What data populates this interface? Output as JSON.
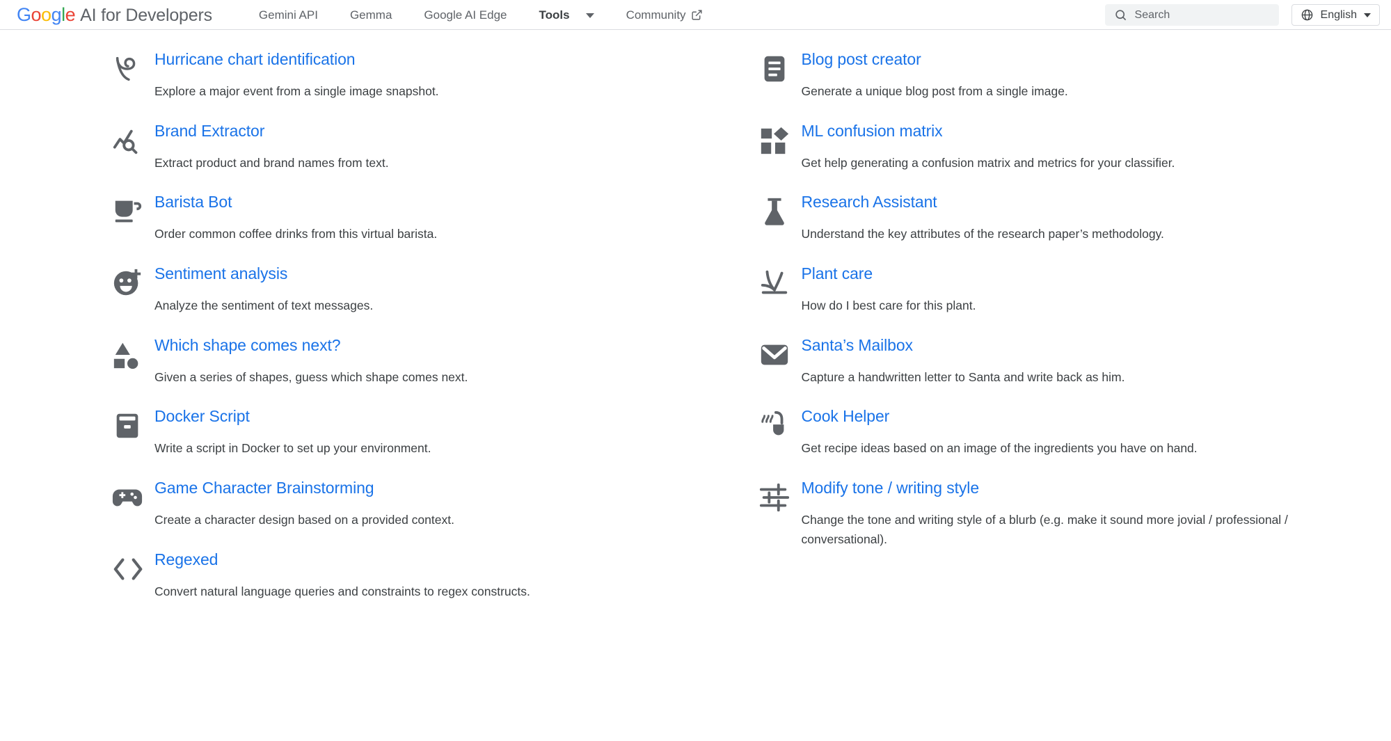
{
  "header": {
    "brand": {
      "google": "Google",
      "suffix": "AI for Developers"
    },
    "nav": [
      {
        "label": "Gemini API",
        "icon": "",
        "active": false
      },
      {
        "label": "Gemma",
        "icon": "",
        "active": false
      },
      {
        "label": "Google AI Edge",
        "icon": "",
        "active": false
      },
      {
        "label": "Tools",
        "icon": "chevron-down-icon",
        "active": true
      },
      {
        "label": "Community",
        "icon": "external-link-icon",
        "active": false
      }
    ],
    "search": {
      "placeholder": "Search",
      "value": "",
      "icon": "search-icon"
    },
    "language": {
      "label": "English",
      "icon": "globe-icon",
      "caret": "caret-down-icon"
    }
  },
  "colors": {
    "link": "#1a73e8",
    "icon": "#5f6368",
    "text": "#3c4043",
    "border": "#dadce0",
    "search_bg": "#f1f3f4",
    "google_blue": "#4285F4",
    "google_red": "#EA4335",
    "google_yellow": "#FBBC05",
    "google_green": "#34A853"
  },
  "left_column": [
    {
      "icon": "hurricane-icon",
      "title": "Hurricane chart identification",
      "description": "Explore a major event from a single image snapshot."
    },
    {
      "icon": "trend-search-icon",
      "title": "Brand Extractor",
      "description": "Extract product and brand names from text."
    },
    {
      "icon": "coffee-cup-icon",
      "title": "Barista Bot",
      "description": "Order common coffee drinks from this virtual barista."
    },
    {
      "icon": "mood-plus-icon",
      "title": "Sentiment analysis",
      "description": "Analyze the sentiment of text messages."
    },
    {
      "icon": "shapes-icon",
      "title": "Which shape comes next?",
      "description": "Given a series of shapes, guess which shape comes next."
    },
    {
      "icon": "docker-container-icon",
      "title": "Docker Script",
      "description": "Write a script in Docker to set up your environment."
    },
    {
      "icon": "gamepad-icon",
      "title": "Game Character Brainstorming",
      "description": "Create a character design based on a provided context."
    },
    {
      "icon": "code-brackets-icon",
      "title": "Regexed",
      "description": "Convert natural language queries and constraints to regex constructs."
    }
  ],
  "right_column": [
    {
      "icon": "article-icon",
      "title": "Blog post creator",
      "description": "Generate a unique blog post from a single image."
    },
    {
      "icon": "dashboard-matrix-icon",
      "title": "ML confusion matrix",
      "description": "Get help generating a confusion matrix and metrics for your classifier."
    },
    {
      "icon": "flask-icon",
      "title": "Research Assistant",
      "description": "Understand the key attributes of the research paper’s methodology."
    },
    {
      "icon": "plant-icon",
      "title": "Plant care",
      "description": "How do I best care for this plant."
    },
    {
      "icon": "envelope-icon",
      "title": "Santa’s Mailbox",
      "description": "Capture a handwritten letter to Santa and write back as him."
    },
    {
      "icon": "cooking-pot-icon",
      "title": "Cook Helper",
      "description": "Get recipe ideas based on an image of the ingredients you have on hand."
    },
    {
      "icon": "tune-sliders-icon",
      "title": "Modify tone / writing style",
      "description": "Change the tone and writing style of a blurb (e.g. make it sound more jovial / professional / conversational)."
    }
  ]
}
